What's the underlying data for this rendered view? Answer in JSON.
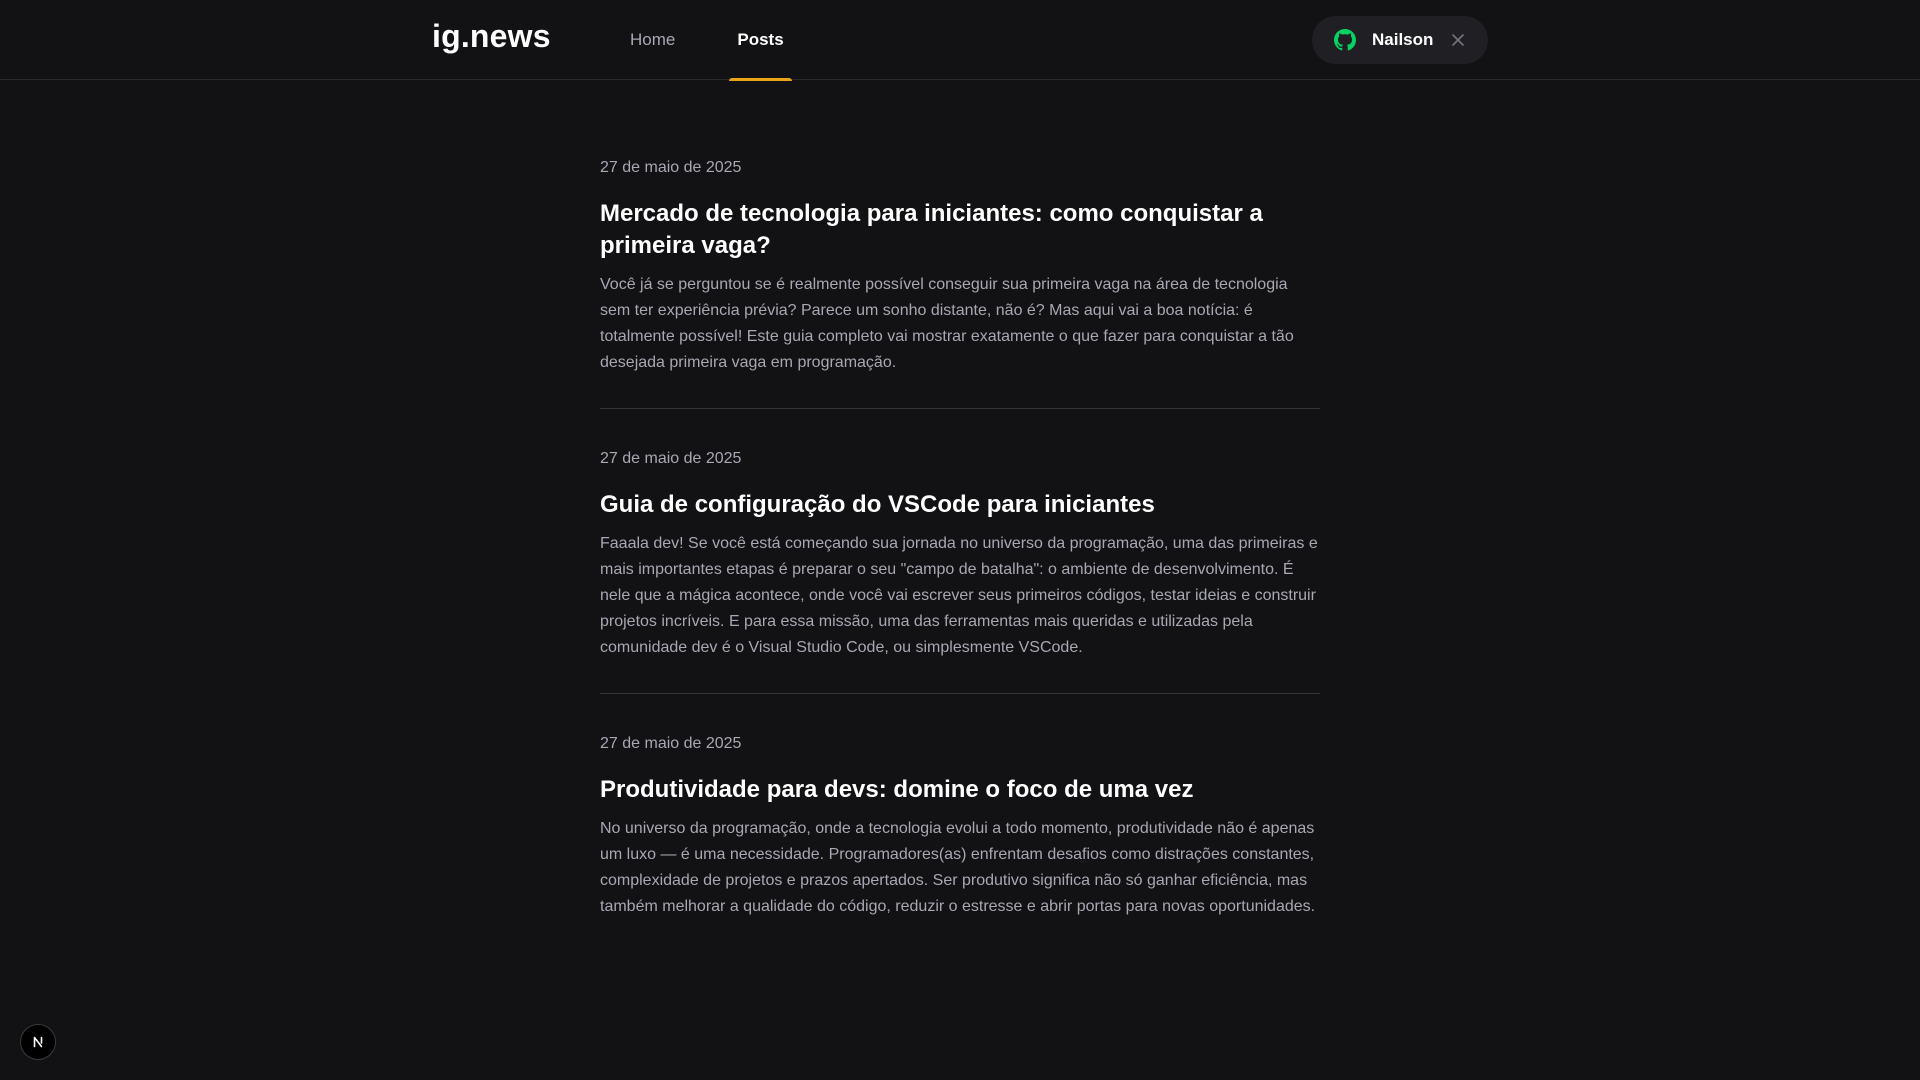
{
  "header": {
    "logo": "ig.news",
    "nav": [
      {
        "label": "Home",
        "active": false
      },
      {
        "label": "Posts",
        "active": true
      }
    ],
    "user": {
      "name": "Nailson",
      "icon": "github-icon",
      "close_icon": "close-icon"
    }
  },
  "posts": [
    {
      "date": "27 de maio de 2025",
      "title": "Mercado de tecnologia para iniciantes: como conquistar a primeira vaga?",
      "excerpt": "Você já se perguntou se é realmente possível conseguir sua primeira vaga na área de tecnologia sem ter experiência prévia? Parece um sonho distante, não é? Mas aqui vai a boa notícia: é totalmente possível! Este guia completo vai mostrar exatamente o que fazer para conquistar a tão desejada primeira vaga em programação."
    },
    {
      "date": "27 de maio de 2025",
      "title": "Guia de configuração do VSCode para iniciantes",
      "excerpt": "Faaala dev! Se você está começando sua jornada no universo da programação, uma das primeiras e mais importantes etapas é preparar o seu \"campo de batalha\": o ambiente de desenvolvimento. É nele que a mágica acontece, onde você vai escrever seus primeiros códigos, testar ideias e construir projetos incríveis. E para essa missão, uma das ferramentas mais queridas e utilizadas pela comunidade dev é o Visual Studio Code, ou simplesmente VSCode."
    },
    {
      "date": "27 de maio de 2025",
      "title": "Produtividade para devs: domine o foco de uma vez",
      "excerpt": "No universo da programação, onde a tecnologia evolui a todo momento, produtividade não é apenas um luxo — é uma necessidade. Programadores(as) enfrentam desafios como distrações constantes, complexidade de projetos e prazos apertados. Ser produtivo significa não só ganhar eficiência, mas também melhorar a qualidade do código, reduzir o estresse e abrir portas para novas oportunidades."
    }
  ],
  "dev_badge": {
    "label": "N",
    "icon": "nextjs-icon"
  },
  "colors": {
    "background": "#121214",
    "accent": "#eba417",
    "github_green": "#04d361",
    "text_muted": "#a8a8b3",
    "button_bg": "#202024"
  }
}
